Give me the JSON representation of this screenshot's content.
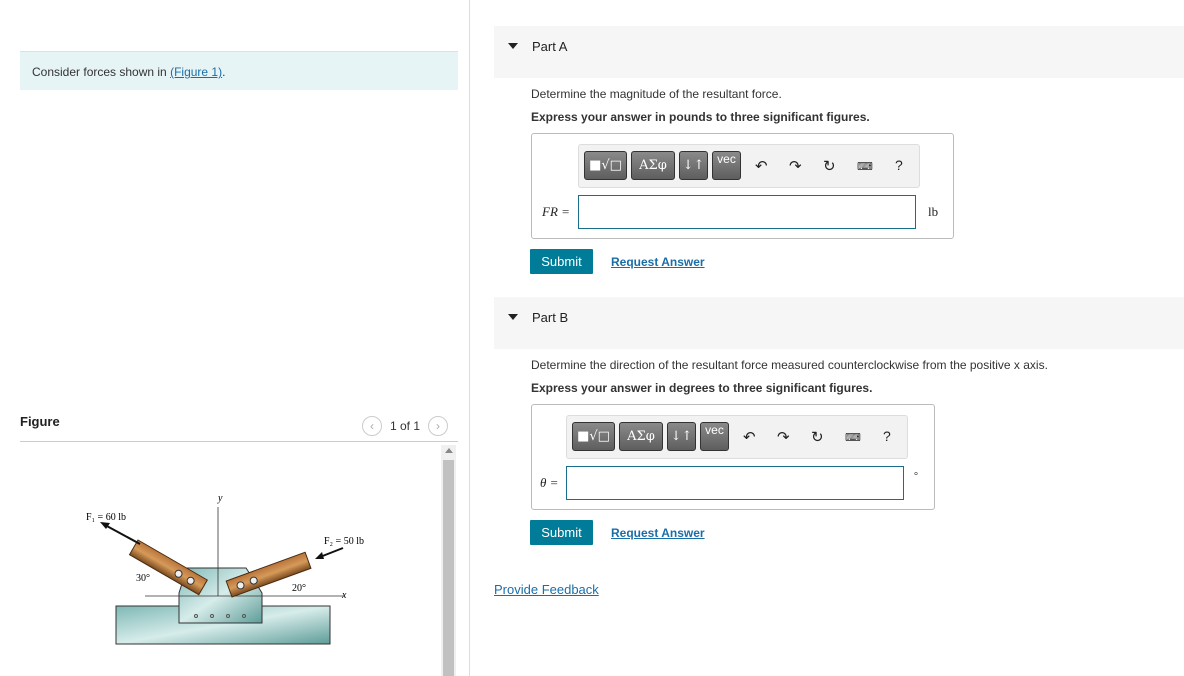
{
  "problem": {
    "intro_prefix": "Consider forces shown in ",
    "figure_link": "(Figure 1)",
    "intro_suffix": "."
  },
  "figure": {
    "label": "Figure",
    "pager": "1 of 1",
    "f1_label": "F₁ = 60 lb",
    "f2_label": "F₂ = 50 lb",
    "angle1": "30°",
    "angle2": "20°",
    "x_axis": "x",
    "y_axis": "y"
  },
  "toolbar": {
    "templates": "■√□",
    "greek": "ΑΣφ",
    "arrows": "↓↑",
    "vec": "vec",
    "help": "?"
  },
  "parts": [
    {
      "title": "Part A",
      "question": "Determine the magnitude of the resultant force.",
      "instruction": "Express your answer in pounds to three significant figures.",
      "variable": "FR =",
      "value": "",
      "unit": "lb",
      "submit": "Submit",
      "request": "Request Answer"
    },
    {
      "title": "Part B",
      "question": "Determine the direction of the resultant force measured counterclockwise from the positive x axis.",
      "instruction": "Express your answer in degrees to three significant figures.",
      "variable": "θ =",
      "value": "",
      "unit": "°",
      "submit": "Submit",
      "request": "Request Answer"
    }
  ],
  "feedback": "Provide Feedback"
}
